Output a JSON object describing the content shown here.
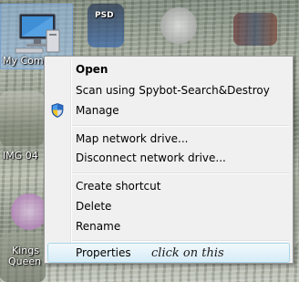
{
  "desktop": {
    "icons": [
      {
        "label": "My Compu"
      },
      {
        "label": "PSD"
      },
      {
        "label": "IMG 04"
      },
      {
        "label": "Kings"
      },
      {
        "label": "Queen"
      }
    ]
  },
  "context_menu": {
    "items": [
      {
        "label": "Open",
        "bold": true
      },
      {
        "label": "Scan using Spybot-Search&Destroy"
      },
      {
        "label": "Manage",
        "icon": "shield-icon"
      },
      {
        "label": "Map network drive..."
      },
      {
        "label": "Disconnect network drive..."
      },
      {
        "label": "Create shortcut"
      },
      {
        "label": "Delete"
      },
      {
        "label": "Rename"
      },
      {
        "label": "Properties",
        "highlighted": true
      }
    ]
  },
  "annotation": {
    "text": "click on this"
  },
  "colors": {
    "menu_bg": "#f0f0f0",
    "menu_border": "#979797",
    "highlight_border": "#a8d8eb",
    "selection_bg": "#96bee8"
  }
}
